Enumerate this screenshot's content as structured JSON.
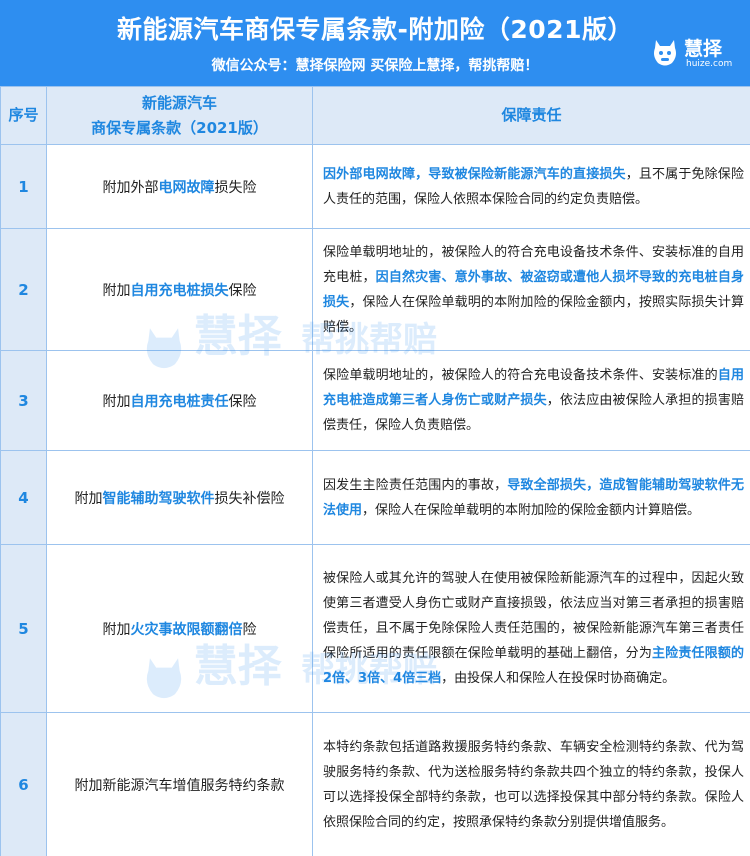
{
  "header": {
    "title": "新能源汽车商保专属条款-附加险（2021版）",
    "subtitle": "微信公众号：慧择保险网   买保险上慧择，帮挑帮赔！",
    "logo_text": "慧择",
    "logo_url": "huize.com"
  },
  "watermark": {
    "text": "慧择",
    "sub": "帮挑帮赔"
  },
  "table": {
    "col_num": "序号",
    "col_name_line1": "新能源汽车",
    "col_name_line2": "商保专属条款（2021版）",
    "col_resp": "保障责任",
    "rows": [
      {
        "num": "1",
        "name_pre": "附加外部",
        "name_hl": "电网故障",
        "name_post": "损失险",
        "d1": "",
        "h1": "因外部电网故障，导致被保险新能源汽车的直接损失",
        "d2": "，且不属于免除保险人责任的范围，保险人依照本保险合同的约定负责赔偿。",
        "h2": "",
        "d3": ""
      },
      {
        "num": "2",
        "name_pre": "附加",
        "name_hl": "自用充电桩损失",
        "name_post": "保险",
        "d1": "保险单载明地址的，被保险人的符合充电设备技术条件、安装标准的自用充电桩，",
        "h1": "因自然灾害、意外事故、被盗窃或遭他人损坏导致的充电桩自身损失",
        "d2": "，保险人在保险单载明的本附加险的保险金额内，按照实际损失计算赔偿。",
        "h2": "",
        "d3": ""
      },
      {
        "num": "3",
        "name_pre": "附加",
        "name_hl": "自用充电桩责任",
        "name_post": "保险",
        "d1": "保险单载明地址的，被保险人的符合充电设备技术条件、安装标准的",
        "h1": "自用充电桩造成第三者人身伤亡或财产损失",
        "d2": "，依法应由被保险人承担的损害赔偿责任，保险人负责赔偿。",
        "h2": "",
        "d3": ""
      },
      {
        "num": "4",
        "name_pre": "附加",
        "name_hl": "智能辅助驾驶软件",
        "name_post": "损失补偿险",
        "d1": "因发生主险责任范围内的事故，",
        "h1": "导致全部损失，造成智能辅助驾驶软件无法使用",
        "d2": "，保险人在保险单载明的本附加险的保险金额内计算赔偿。",
        "h2": "",
        "d3": ""
      },
      {
        "num": "5",
        "name_pre": "附加",
        "name_hl": "火灾事故限额翻倍",
        "name_post": "险",
        "d1": "被保险人或其允许的驾驶人在使用被保险新能源汽车的过程中，因起火致使第三者遭受人身伤亡或财产直接损毁，依法应当对第三者承担的损害赔偿责任，且不属于免除保险人责任范围的，被保险新能源汽车第三者责任保险所适用的责任限额在保险单载明的基础上翻倍，分为",
        "h1": "主险责任限额的2倍、3倍、4倍三档",
        "d2": "，由投保人和保险人在投保时协商确定。",
        "h2": "",
        "d3": ""
      },
      {
        "num": "6",
        "name_pre": "附加新能源汽车增值服务特约条款",
        "name_hl": "",
        "name_post": "",
        "d1": "本特约条款包括道路救援服务特约条款、车辆安全检测特约条款、代为驾驶服务特约条款、代为送检服务特约条款共四个独立的特约条款，投保人可以选择投保全部特约条款，也可以选择投保其中部分特约条款。保险人依照保险合同的约定，按照承保特约条款分别提供增值服务。",
        "h1": "",
        "d2": "",
        "h2": "",
        "d3": ""
      }
    ]
  },
  "colors": {
    "accent": "#2e8ef0",
    "highlight": "#1f87e0",
    "header_bg": "#dde9f7",
    "border": "#9cc3ee"
  },
  "icons": {
    "logo": "horse-mascot-icon"
  }
}
